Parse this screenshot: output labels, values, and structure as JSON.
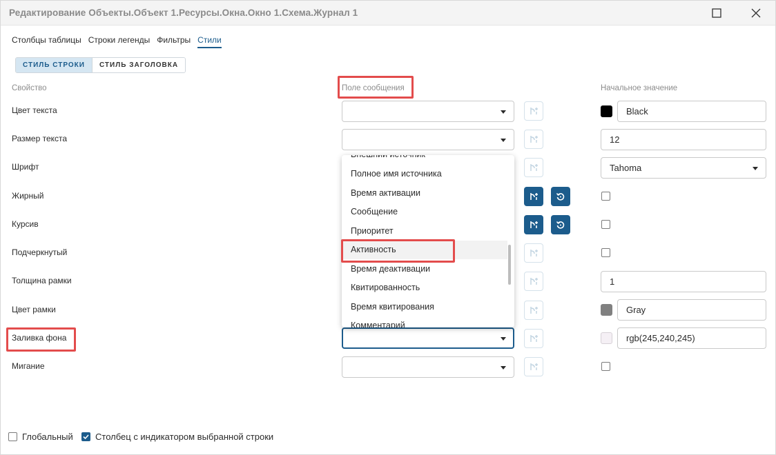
{
  "window": {
    "title": "Редактирование Объекты.Объект 1.Ресурсы.Окна.Окно 1.Схема.Журнал 1"
  },
  "tabs": [
    {
      "label": "Столбцы таблицы",
      "active": false
    },
    {
      "label": "Строки легенды",
      "active": false
    },
    {
      "label": "Фильтры",
      "active": false
    },
    {
      "label": "Стили",
      "active": true
    }
  ],
  "style_toggle": {
    "row_style": "СТИЛЬ СТРОКИ",
    "header_style": "СТИЛЬ ЗАГОЛОВКА",
    "selected": "row_style"
  },
  "columns": {
    "property": "Свойство",
    "message_field": "Поле сообщения",
    "initial_value": "Начальное значение"
  },
  "properties": [
    {
      "label": "Цвет текста",
      "initial": "Black",
      "swatch_color": "#000000"
    },
    {
      "label": "Размер текста",
      "initial": "12"
    },
    {
      "label": "Шрифт",
      "initial": "Tahoma"
    },
    {
      "label": "Жирный",
      "checked": false
    },
    {
      "label": "Курсив",
      "checked": false
    },
    {
      "label": "Подчеркнутый",
      "checked": false
    },
    {
      "label": "Толщина рамки",
      "initial": "1"
    },
    {
      "label": "Цвет рамки",
      "initial": "Gray",
      "swatch_color": "#808080"
    },
    {
      "label": "Заливка фона",
      "initial": "rgb(245,240,245)",
      "swatch_color": "#f5f0f5"
    },
    {
      "label": "Мигание",
      "checked": false
    }
  ],
  "dropdown": {
    "items": [
      "Внешний источник",
      "Полное имя источника",
      "Время активации",
      "Сообщение",
      "Приоритет",
      "Активность",
      "Время деактивации",
      "Квитированность",
      "Время квитирования",
      "Комментарий"
    ],
    "hovered": "Активность"
  },
  "footer": {
    "global_label": "Глобальный",
    "global_checked": false,
    "indicator_label": "Столбец с индикатором выбранной строки",
    "indicator_checked": true
  },
  "colors": {
    "accent": "#1c5c8c",
    "highlight": "#e34c4c"
  }
}
